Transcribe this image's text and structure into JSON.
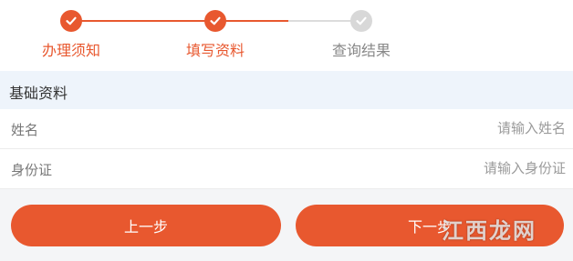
{
  "steps": [
    {
      "label": "办理须知",
      "status": "done"
    },
    {
      "label": "填写资料",
      "status": "done"
    },
    {
      "label": "查询结果",
      "status": "todo"
    }
  ],
  "section": {
    "title": "基础资料"
  },
  "form": {
    "name": {
      "label": "姓名",
      "placeholder": "请输入姓名",
      "value": ""
    },
    "id_card": {
      "label": "身份证",
      "placeholder": "请输入身份证",
      "value": ""
    }
  },
  "buttons": {
    "prev": "上一步",
    "next": "下一步"
  },
  "colors": {
    "accent": "#e8582f",
    "inactive": "#d8d8d8",
    "section_bg": "#eef4fb"
  },
  "icons": {
    "done_step": "check-icon",
    "todo_step": "check-icon"
  },
  "watermark": "江西龙网"
}
